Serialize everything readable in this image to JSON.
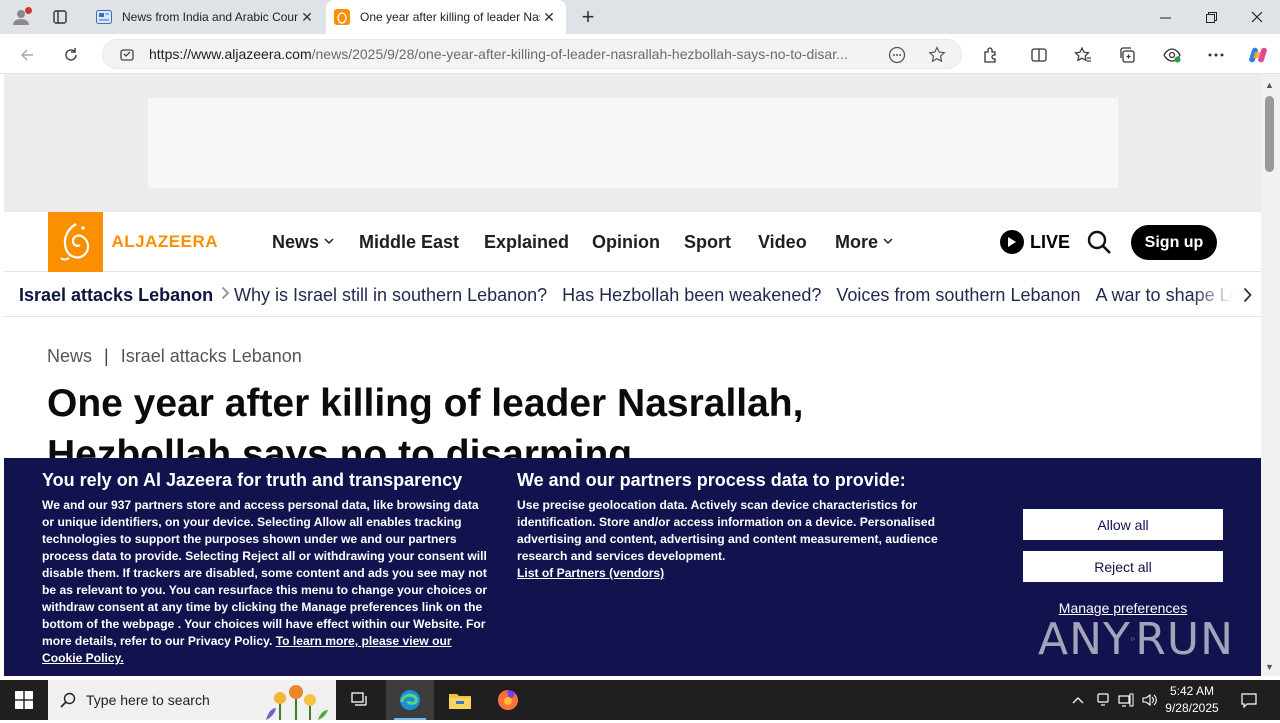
{
  "browser": {
    "tabs": [
      {
        "title": "News from India and Arabic Countries",
        "close": "✕"
      },
      {
        "title": "One year after killing of leader Nasrallah",
        "close": "✕"
      }
    ],
    "url_host": "https://www.aljazeera.com",
    "url_path": "/news/2025/9/28/one-year-after-killing-of-leader-nasrallah-hezbollah-says-no-to-disar..."
  },
  "site": {
    "logo_text": "ALJAZEERA",
    "nav": {
      "news": "News",
      "middle_east": "Middle East",
      "explained": "Explained",
      "opinion": "Opinion",
      "sport": "Sport",
      "video": "Video",
      "more": "More"
    },
    "live_label": "LIVE",
    "signup_label": "Sign up"
  },
  "topics": {
    "main": "Israel attacks Lebanon",
    "links": [
      "Why is Israel still in southern Lebanon?",
      "Has Hezbollah been weakened?",
      "Voices from southern Lebanon",
      "A war to shape Lebanon"
    ]
  },
  "article": {
    "breadcrumb_section": "News",
    "breadcrumb_topic": "Israel attacks Lebanon",
    "headline": "One year after killing of leader Nasrallah, Hezbollah says no to disarming"
  },
  "consent": {
    "left_title": "You rely on Al Jazeera for truth and transparency",
    "left_text_1": "We and our ",
    "partner_count": "937",
    "left_text_2": " partners store and access personal data, like browsing data or unique identifiers, on your device. Selecting Allow all enables tracking technologies to support the purposes shown under we and our partners process data to provide. Selecting Reject all or withdrawing your consent will disable them. If trackers are disabled, some content and ads you see may not be as relevant to you. You can resurface this menu to change your choices or withdraw consent at any time by clicking the Manage preferences link on the bottom of the webpage . Your choices will have effect within our Website. For more details, refer to our Privacy Policy. ",
    "left_link": "To learn more, please view our Cookie Policy.",
    "mid_title": "We and our partners process data to provide:",
    "mid_text": "Use precise geolocation data. Actively scan device characteristics for identification. Store and/or access information on a device. Personalised advertising and content, advertising and content measurement, audience research and services development.",
    "mid_link": "List of Partners (vendors)",
    "allow_all": "Allow all",
    "reject_all": "Reject all",
    "manage": "Manage preferences"
  },
  "watermark": {
    "text1": "ANY",
    "text2": "RUN"
  },
  "taskbar": {
    "search_placeholder": "Type here to search",
    "time": "5:42 AM",
    "date": "9/28/2025"
  },
  "colors": {
    "brand_orange": "#fa9000",
    "consent_bg": "#12124f",
    "nav_text": "#1f1f1f"
  }
}
